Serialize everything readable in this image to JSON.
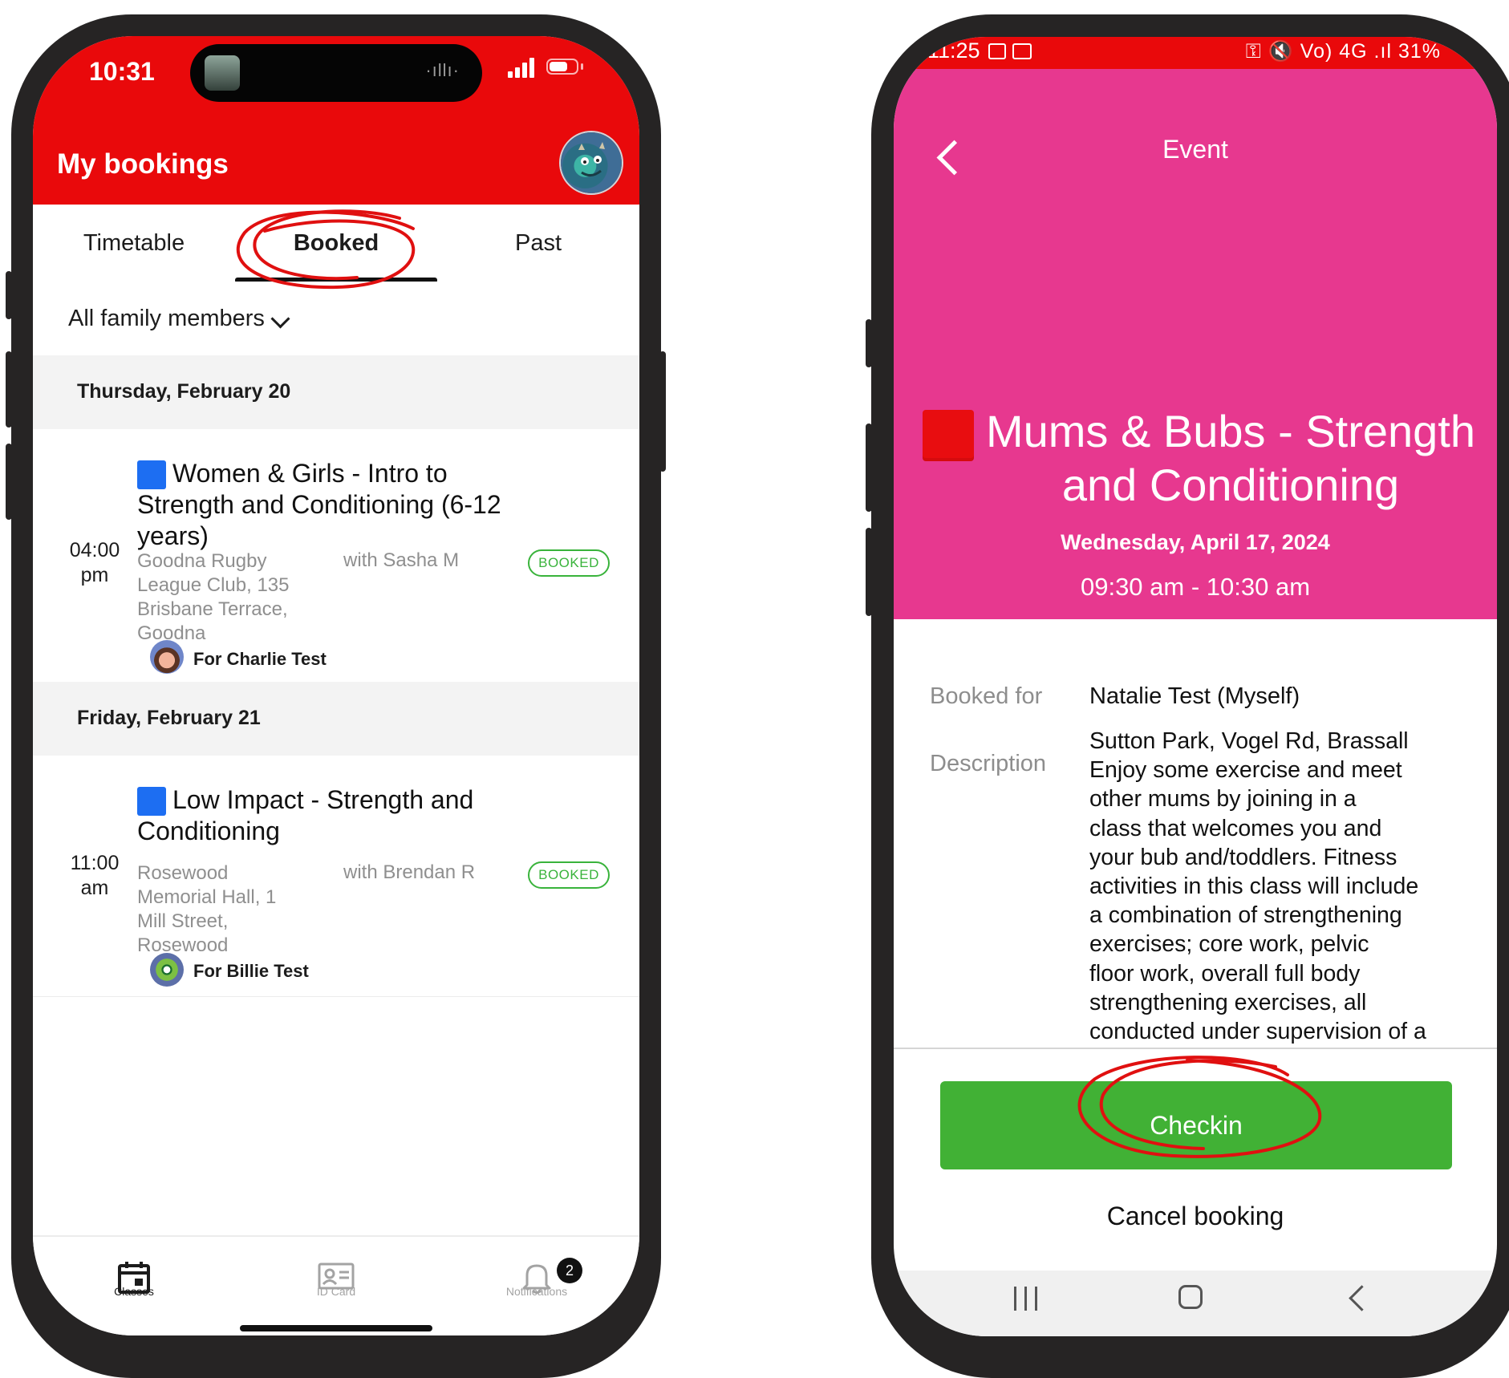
{
  "left_phone": {
    "status": {
      "time": "10:31",
      "island_wave": "·ıllı·"
    },
    "header": {
      "title": "My bookings"
    },
    "tabs": [
      {
        "label": "Timetable"
      },
      {
        "label": "Booked"
      },
      {
        "label": "Past"
      }
    ],
    "filter": {
      "label": "All family members"
    },
    "days": [
      {
        "date": "Thursday, February 20",
        "booking": {
          "title_lines": [
            "Women & Girls - Intro to",
            "Strength and Conditioning (6-12",
            "years)"
          ],
          "time_lines": [
            "04:00",
            "pm"
          ],
          "location_lines": [
            "Goodna Rugby",
            "League Club, 135",
            "Brisbane Terrace,",
            "Goodna"
          ],
          "instructor": "with Sasha M",
          "status": "BOOKED",
          "for": "For Charlie Test"
        }
      },
      {
        "date": "Friday, February 21",
        "booking": {
          "title_lines": [
            "Low Impact - Strength and",
            "Conditioning"
          ],
          "time_lines": [
            "11:00",
            "am"
          ],
          "location_lines": [
            "Rosewood",
            "Memorial Hall, 1",
            "Mill Street,",
            "Rosewood"
          ],
          "instructor": "with Brendan R",
          "status": "BOOKED",
          "for": "For Billie Test"
        }
      }
    ],
    "bottom_nav": [
      {
        "label": "Classes",
        "icon": "calendar-icon"
      },
      {
        "label": "ID Card",
        "icon": "id-card-icon"
      },
      {
        "label": "Notifications",
        "icon": "bell-icon"
      }
    ],
    "notification_count": "2"
  },
  "right_phone": {
    "status": {
      "time": "11:25",
      "icons": "⚿ 🔇 Vo) 4G .ıl 31%"
    },
    "header": {
      "title": "Event"
    },
    "event": {
      "title_lines": [
        "Mums & Bubs - Strength",
        "and Conditioning"
      ],
      "date": "Wednesday, April 17, 2024",
      "time": "09:30 am - 10:30 am"
    },
    "booked_for": {
      "label": "Booked for",
      "value": "Natalie Test (Myself)"
    },
    "description": {
      "label": "Description",
      "lines": [
        "Sutton Park, Vogel Rd, Brassall",
        "Enjoy some exercise and meet",
        "other mums by joining in a",
        "class that welcomes you and",
        "your bub and/toddlers. Fitness",
        "activities in this class will include",
        "a combination of strengthening",
        "exercises; core work, pelvic",
        "floor work, overall full body",
        "strengthening exercises, all",
        "conducted under supervision of a"
      ]
    },
    "actions": {
      "checkin": "Checkin",
      "cancel": "Cancel booking"
    }
  },
  "colors": {
    "header_red": "#e9090b",
    "event_pink": "#e7388f",
    "booked_green": "#39b33b",
    "checkin_green": "#41b135",
    "class_blue": "#1d6ef2",
    "annotation_red": "#e01010"
  }
}
